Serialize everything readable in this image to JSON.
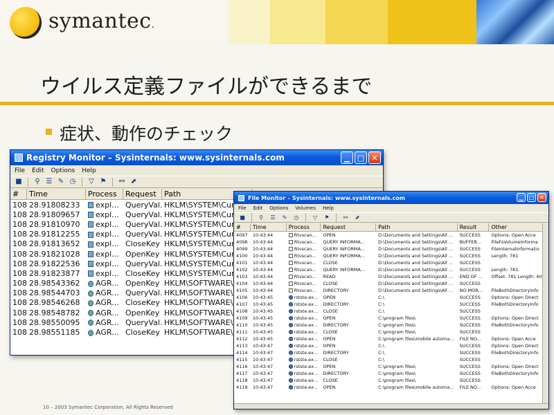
{
  "slide": {
    "logo_text": "symantec",
    "logo_dot": ".",
    "title": "ウイルス定義ファイルができるまで",
    "bullet": "症状、動作のチェック",
    "footer": "10 – 2003 Symantec Corporation, All Rights Reserved",
    "colors": {
      "accent": "#e9b21c",
      "logo": "#f2b700"
    }
  },
  "registry_monitor": {
    "title": "Registry Monitor – Sysinternals: www.sysinternals.com",
    "menu": [
      "File",
      "Edit",
      "Options",
      "Help"
    ],
    "columns": [
      "#",
      "Time",
      "Process",
      "Request",
      "Path"
    ],
    "rows": [
      [
        "108...",
        "28.91808233",
        "expl...",
        "QueryVal...",
        "HKLM\\SYSTEM\\Cur"
      ],
      [
        "108...",
        "28.91809657",
        "expl...",
        "QueryVal...",
        "HKLM\\SYSTEM\\Cur"
      ],
      [
        "108...",
        "28.91810970",
        "expl...",
        "QueryVal...",
        "HKLM\\SYSTEM\\Cur"
      ],
      [
        "108...",
        "28.91812255",
        "expl...",
        "QueryVal...",
        "HKLM\\SYSTEM\\Cur"
      ],
      [
        "108...",
        "28.91813652",
        "expl...",
        "CloseKey",
        "HKLM\\SYSTEM\\Cur"
      ],
      [
        "108...",
        "28.91821028",
        "expl...",
        "OpenKey",
        "HKLM\\SYSTEM\\Cur"
      ],
      [
        "108...",
        "28.91822536",
        "expl...",
        "QueryVal...",
        "HKLM\\SYSTEM\\Cur"
      ],
      [
        "108...",
        "28.91823877",
        "expl...",
        "CloseKey",
        "HKLM\\SYSTEM\\Cur"
      ],
      [
        "108...",
        "28.98543362",
        "AGR...",
        "OpenKey",
        "HKLM\\SOFTWARE\\"
      ],
      [
        "108...",
        "28.98544703",
        "AGR...",
        "QueryVal...",
        "HKLM\\SOFTWARE\\"
      ],
      [
        "108...",
        "28.98546268",
        "AGR...",
        "CloseKey",
        "HKLM\\SOFTWARE\\"
      ],
      [
        "108...",
        "28.98548782",
        "AGR...",
        "OpenKey",
        "HKLM\\SOFTWARE\\"
      ],
      [
        "108...",
        "28.98550095",
        "AGR...",
        "QueryVal...",
        "HKLM\\SOFTWARE\\"
      ],
      [
        "108...",
        "28.98551185",
        "AGR...",
        "CloseKey",
        "HKLM\\SOFTWARE\\"
      ]
    ]
  },
  "file_monitor": {
    "title": "File Monitor – Sysinternals: www.sysinternals.com",
    "menu": [
      "File",
      "Edit",
      "Options",
      "Volumes",
      "Help"
    ],
    "columns": [
      "#",
      "Time",
      "Process",
      "Request",
      "Path",
      "Result",
      "Other"
    ],
    "rows": [
      [
        "4097",
        "10:43:44",
        "Rtvscan...",
        "OPEN",
        "D:\\Documents and Settings\\All ...",
        "SUCCESS",
        "Options: Open Acce"
      ],
      [
        "4098",
        "10:43:44",
        "Rtvscan...",
        "QUERY INFORMA...",
        "D:\\Documents and Settings\\All ...",
        "BUFFER...",
        "FileFsVolumeInforma"
      ],
      [
        "4099",
        "10:43:44",
        "Rtvscan...",
        "QUERY INFORMA...",
        "D:\\Documents and Settings\\All ...",
        "SUCCESS",
        "FileInternalInformatio"
      ],
      [
        "4100",
        "10:43:44",
        "Rtvscan...",
        "QUERY INFORMA...",
        "D:\\Documents and Settings\\All ...",
        "SUCCESS",
        "Length: 781"
      ],
      [
        "4101",
        "10:43:44",
        "Rtvscan...",
        "CLOSE",
        "D:\\Documents and Settings\\All ...",
        "SUCCESS",
        ""
      ],
      [
        "4102",
        "10:43:44",
        "Rtvscan...",
        "QUERY INFORMA...",
        "D:\\Documents and Settings\\All ...",
        "SUCCESS",
        "Length: 781"
      ],
      [
        "4103",
        "10:43:44",
        "Rtvscan...",
        "READ",
        "D:\\Documents and Settings\\All ...",
        "END OF ...",
        "Offset: 781 Length: 40"
      ],
      [
        "4104",
        "10:43:44",
        "Rtvscan...",
        "CLOSE",
        "D:\\Documents and Settings\\All ...",
        "SUCCESS",
        ""
      ],
      [
        "4105",
        "10:43:44",
        "Rtvscan...",
        "DIRECTORY",
        "D:\\Documents and Settings\\All ...",
        "NO MOR...",
        "FileBothDirectoryInfo"
      ],
      [
        "4106",
        "10:43:45",
        "rstste.ex...",
        "OPEN",
        "C:\\",
        "SUCCESS",
        "Options: Open Direct"
      ],
      [
        "4107",
        "10:43:45",
        "rstste.ex...",
        "DIRECTORY",
        "C:\\",
        "SUCCESS",
        "FileBothDirectoryInfo"
      ],
      [
        "4108",
        "10:43:45",
        "rstste.ex...",
        "CLOSE",
        "C:\\",
        "SUCCESS",
        ""
      ],
      [
        "4109",
        "10:43:45",
        "rstste.ex...",
        "OPEN",
        "C:\\program files\\",
        "SUCCESS",
        "Options: Open Direct"
      ],
      [
        "4110",
        "10:43:45",
        "rstste.ex...",
        "DIRECTORY",
        "C:\\program files\\",
        "SUCCESS",
        "FileBothDirectoryInfo"
      ],
      [
        "4111",
        "10:43:45",
        "rstste.ex...",
        "CLOSE",
        "C:\\program files\\",
        "SUCCESS",
        ""
      ],
      [
        "4112",
        "10:43:45",
        "rstste.ex...",
        "OPEN",
        "C:\\program files\\mobile automa...",
        "FILE NO...",
        "Options: Open Acce"
      ],
      [
        "4113",
        "10:43:47",
        "rstste.ex...",
        "OPEN",
        "C:\\",
        "SUCCESS",
        "Options: Open Direct"
      ],
      [
        "4114",
        "10:43:47",
        "rstste.ex...",
        "DIRECTORY",
        "C:\\",
        "SUCCESS",
        "FileBothDirectoryInfo"
      ],
      [
        "4115",
        "10:43:47",
        "rstste.ex...",
        "CLOSE",
        "C:\\",
        "SUCCESS",
        ""
      ],
      [
        "4116",
        "10:43:47",
        "rstste.ex...",
        "OPEN",
        "C:\\program files\\",
        "SUCCESS",
        "Options: Open Direct"
      ],
      [
        "4117",
        "10:43:47",
        "rstste.ex...",
        "DIRECTORY",
        "C:\\program files\\",
        "SUCCESS",
        "FileBothDirectoryInfo"
      ],
      [
        "4118",
        "10:43:47",
        "rstste.ex...",
        "CLOSE",
        "C:\\program files\\",
        "SUCCESS",
        ""
      ],
      [
        "4119",
        "10:43:47",
        "rstste.ex...",
        "OPEN",
        "C:\\program files\\mobile automa...",
        "FILE NO...",
        "Options: Open Acce"
      ]
    ]
  }
}
